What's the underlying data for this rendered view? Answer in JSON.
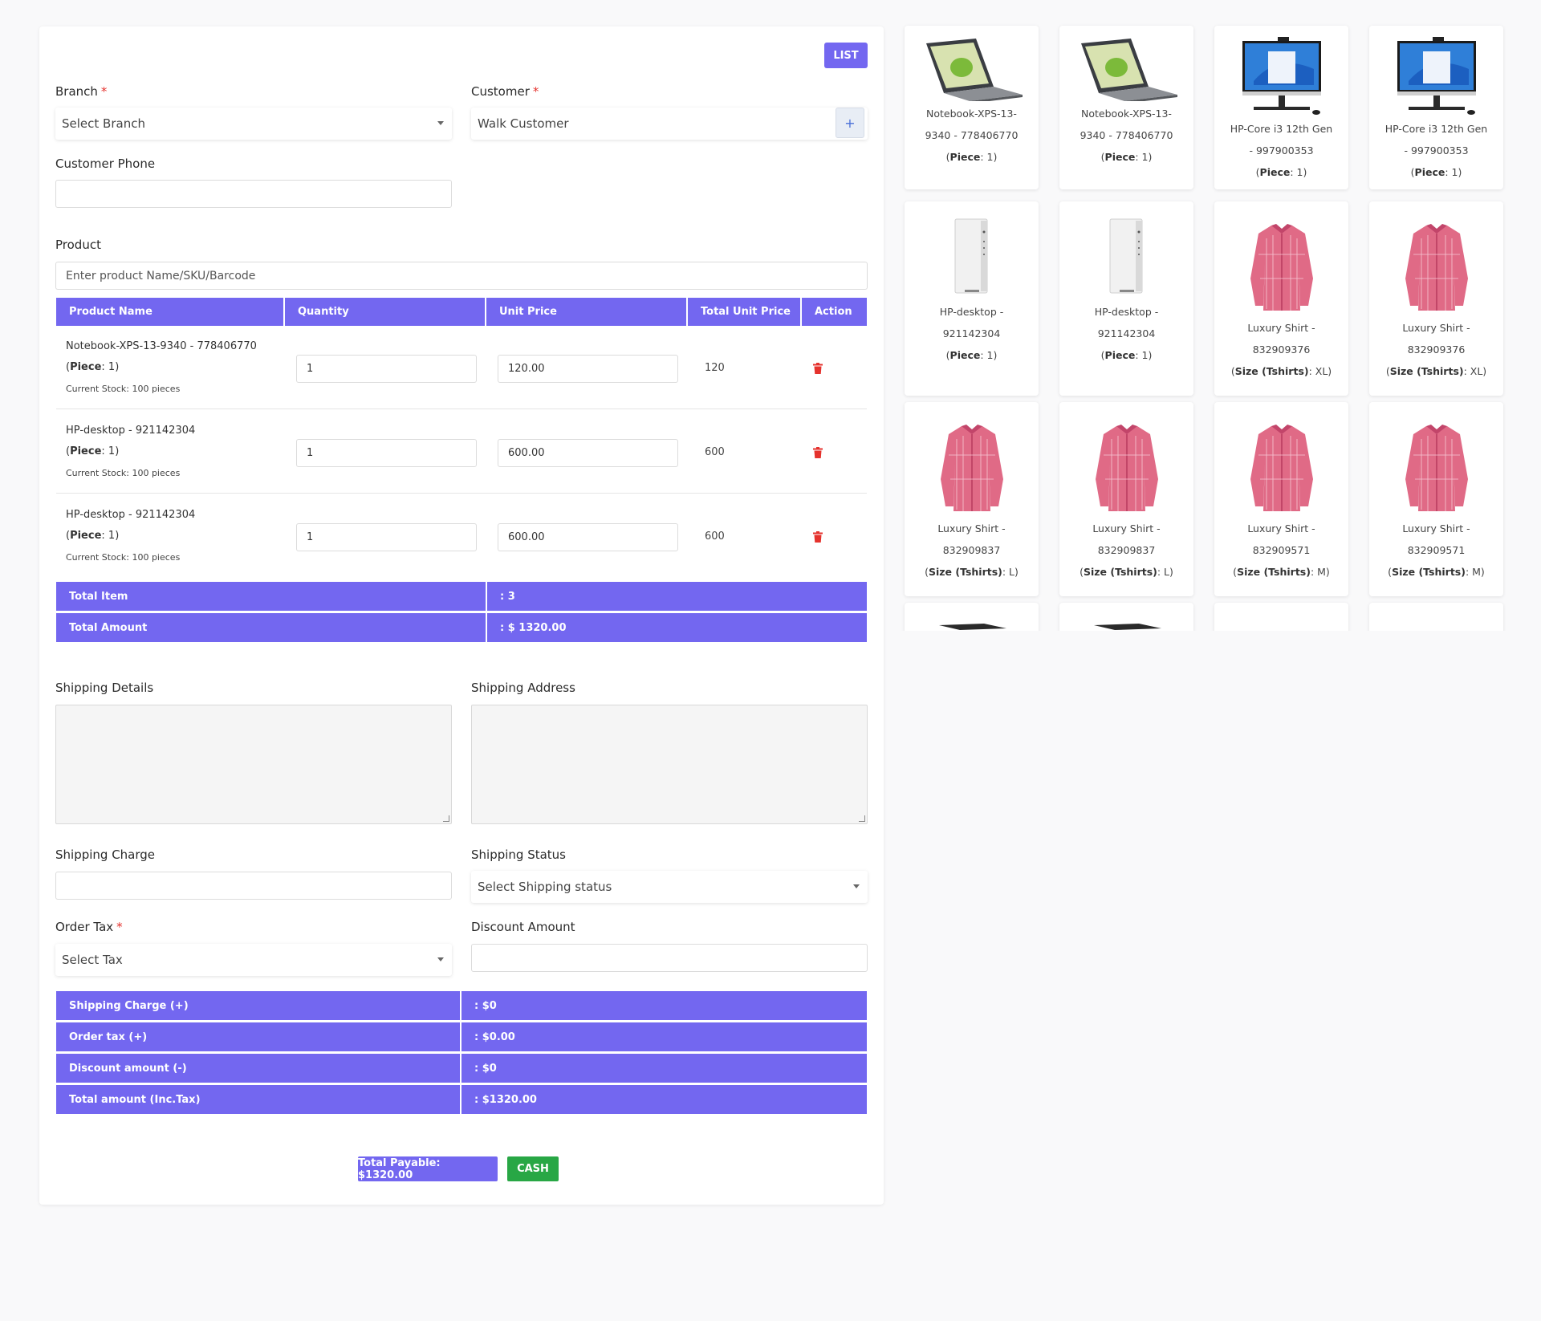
{
  "form": {
    "list_label": "LIST",
    "branch_label": "Branch",
    "branch_value": "Select Branch",
    "customer_label": "Customer",
    "customer_value": "Walk Customer",
    "add_label": "+",
    "required_mark": "*",
    "customer_phone_label": "Customer Phone",
    "customer_phone_value": "",
    "product_label": "Product",
    "product_placeholder": "Enter product Name/SKU/Barcode"
  },
  "table": {
    "headers": [
      "Product Name",
      "Quantity",
      "Unit Price",
      "Total Unit Price",
      "Action"
    ],
    "rows": [
      {
        "name": "Notebook-XPS-13-9340 - 778406770",
        "unit_key": "Piece",
        "unit_val": ": 1)",
        "stock": "Current Stock: 100 pieces",
        "qty": "1",
        "price": "120.00",
        "total": "120"
      },
      {
        "name": "HP-desktop - 921142304",
        "unit_key": "Piece",
        "unit_val": ": 1)",
        "stock": "Current Stock: 100 pieces",
        "qty": "1",
        "price": "600.00",
        "total": "600"
      },
      {
        "name": "HP-desktop - 921142304",
        "unit_key": "Piece",
        "unit_val": ": 1)",
        "stock": "Current Stock: 100 pieces",
        "qty": "1",
        "price": "600.00",
        "total": "600"
      }
    ],
    "total_item_label": "Total Item",
    "total_item_value": ": 3",
    "total_amount_label": "Total Amount",
    "total_amount_value": ": $ 1320.00"
  },
  "shipping": {
    "details_label": "Shipping Details",
    "address_label": "Shipping Address",
    "charge_label": "Shipping Charge",
    "charge_value": "",
    "status_label": "Shipping Status",
    "status_value": "Select Shipping status",
    "tax_label": "Order Tax",
    "tax_value": "Select Tax",
    "discount_label": "Discount Amount",
    "discount_value": ""
  },
  "summary": [
    {
      "label": "Shipping Charge (+)",
      "value": ": $0"
    },
    {
      "label": "Order tax (+)",
      "value": ": $0.00"
    },
    {
      "label": "Discount amount (-)",
      "value": ": $0"
    },
    {
      "label": "Total amount (Inc.Tax)",
      "value": ": $1320.00"
    }
  ],
  "footer": {
    "total_payable": "Total Payable: $1320.00",
    "cash": "CASH"
  },
  "products": [
    {
      "l1": "Notebook-XPS-13-",
      "l2": "9340 - 778406770",
      "k": "Piece",
      "v": ": 1)",
      "icon": "laptop-image"
    },
    {
      "l1": "Notebook-XPS-13-",
      "l2": "9340 - 778406770",
      "k": "Piece",
      "v": ": 1)",
      "icon": "laptop-image"
    },
    {
      "l1": "HP-Core i3 12th Gen",
      "l2": "- 997900353",
      "k": "Piece",
      "v": ": 1)",
      "icon": "monitor-image"
    },
    {
      "l1": "HP-Core i3 12th Gen",
      "l2": "- 997900353",
      "k": "Piece",
      "v": ": 1)",
      "icon": "monitor-image"
    },
    {
      "l1": "HP-desktop -",
      "l2": "921142304",
      "k": "Piece",
      "v": ": 1)",
      "icon": "desktop-tower-image"
    },
    {
      "l1": "HP-desktop -",
      "l2": "921142304",
      "k": "Piece",
      "v": ": 1)",
      "icon": "desktop-tower-image"
    },
    {
      "l1": "Luxury Shirt -",
      "l2": "832909376",
      "k": "Size (Tshirts)",
      "v": ": XL)",
      "icon": "shirt-image"
    },
    {
      "l1": "Luxury Shirt -",
      "l2": "832909376",
      "k": "Size (Tshirts)",
      "v": ": XL)",
      "icon": "shirt-image"
    },
    {
      "l1": "Luxury Shirt -",
      "l2": "832909837",
      "k": "Size (Tshirts)",
      "v": ": L)",
      "icon": "shirt-image"
    },
    {
      "l1": "Luxury Shirt -",
      "l2": "832909837",
      "k": "Size (Tshirts)",
      "v": ": L)",
      "icon": "shirt-image"
    },
    {
      "l1": "Luxury Shirt -",
      "l2": "832909571",
      "k": "Size (Tshirts)",
      "v": ": M)",
      "icon": "shirt-image"
    },
    {
      "l1": "Luxury Shirt -",
      "l2": "832909571",
      "k": "Size (Tshirts)",
      "v": ": M)",
      "icon": "shirt-image"
    }
  ],
  "colors": {
    "accent": "#7367f0",
    "success": "#28a745",
    "danger": "#e5322d",
    "shirt": "#e06a86"
  }
}
